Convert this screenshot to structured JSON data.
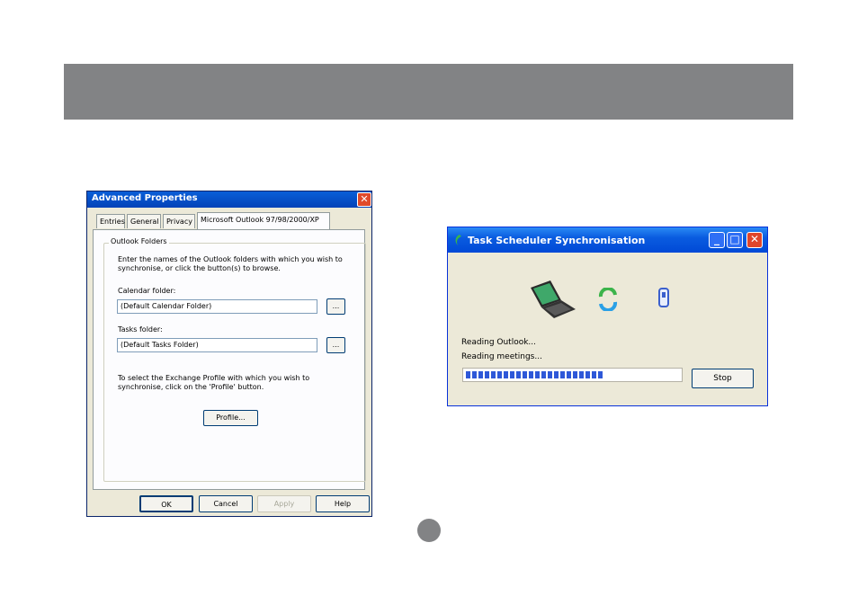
{
  "advanced_properties": {
    "title": "Advanced Properties",
    "tabs": [
      "Entries",
      "General",
      "Privacy",
      "Microsoft Outlook 97/98/2000/XP"
    ],
    "group_label": "Outlook Folders",
    "intro_line1": "Enter the names of the Outlook folders with which you wish to",
    "intro_line2": "synchronise, or click the button(s) to browse.",
    "calendar_label": "Calendar folder:",
    "calendar_value": "(Default Calendar Folder)",
    "tasks_label": "Tasks folder:",
    "tasks_value": "(Default Tasks Folder)",
    "browse_label": "...",
    "profile_text_line1": "To select the Exchange Profile with which you wish to",
    "profile_text_line2": "synchronise, click on the 'Profile' button.",
    "profile_button": "Profile...",
    "ok_button": "OK",
    "cancel_button": "Cancel",
    "apply_button": "Apply",
    "help_button": "Help",
    "close_glyph": "✕"
  },
  "task_scheduler": {
    "title": "Task Scheduler Synchronisation",
    "status_line1": "Reading Outlook...",
    "status_line2": "Reading meetings...",
    "stop_button": "Stop",
    "progress": 0.64,
    "minimize_glyph": "_",
    "maximize_glyph": "□",
    "close_glyph": "✕",
    "accent_color": "#2e58d8"
  }
}
